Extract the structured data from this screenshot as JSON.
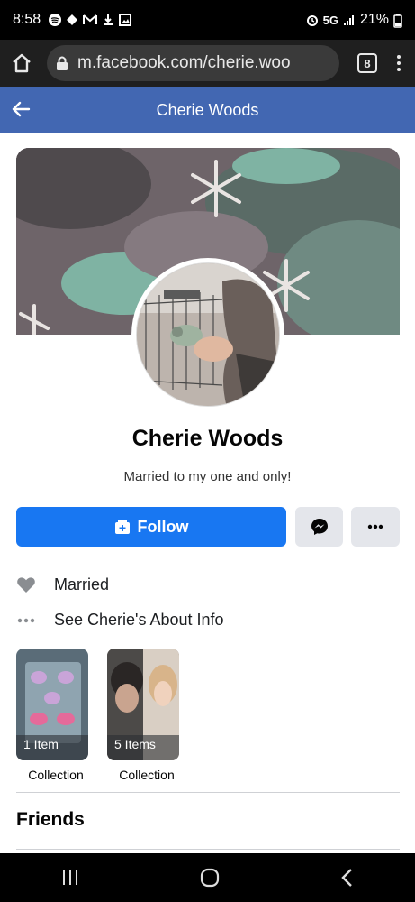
{
  "status_bar": {
    "time": "8:58",
    "network": "5G",
    "battery": "21%"
  },
  "browser": {
    "url": "m.facebook.com/cherie.woo",
    "tab_count": "8"
  },
  "header": {
    "title": "Cherie Woods"
  },
  "profile": {
    "name": "Cherie Woods",
    "bio": "Married to my one and only!",
    "follow_label": "Follow"
  },
  "info": {
    "relationship": "Married",
    "about_link": "See Cherie's About Info"
  },
  "collections": [
    {
      "count": "1 Item",
      "caption": "Collection"
    },
    {
      "count": "5 Items",
      "caption": "Collection"
    }
  ],
  "sections": {
    "friends_title": "Friends"
  },
  "colors": {
    "fb_header": "#4267b2",
    "follow_button": "#1877f2",
    "secondary_button": "#e4e6eb"
  }
}
